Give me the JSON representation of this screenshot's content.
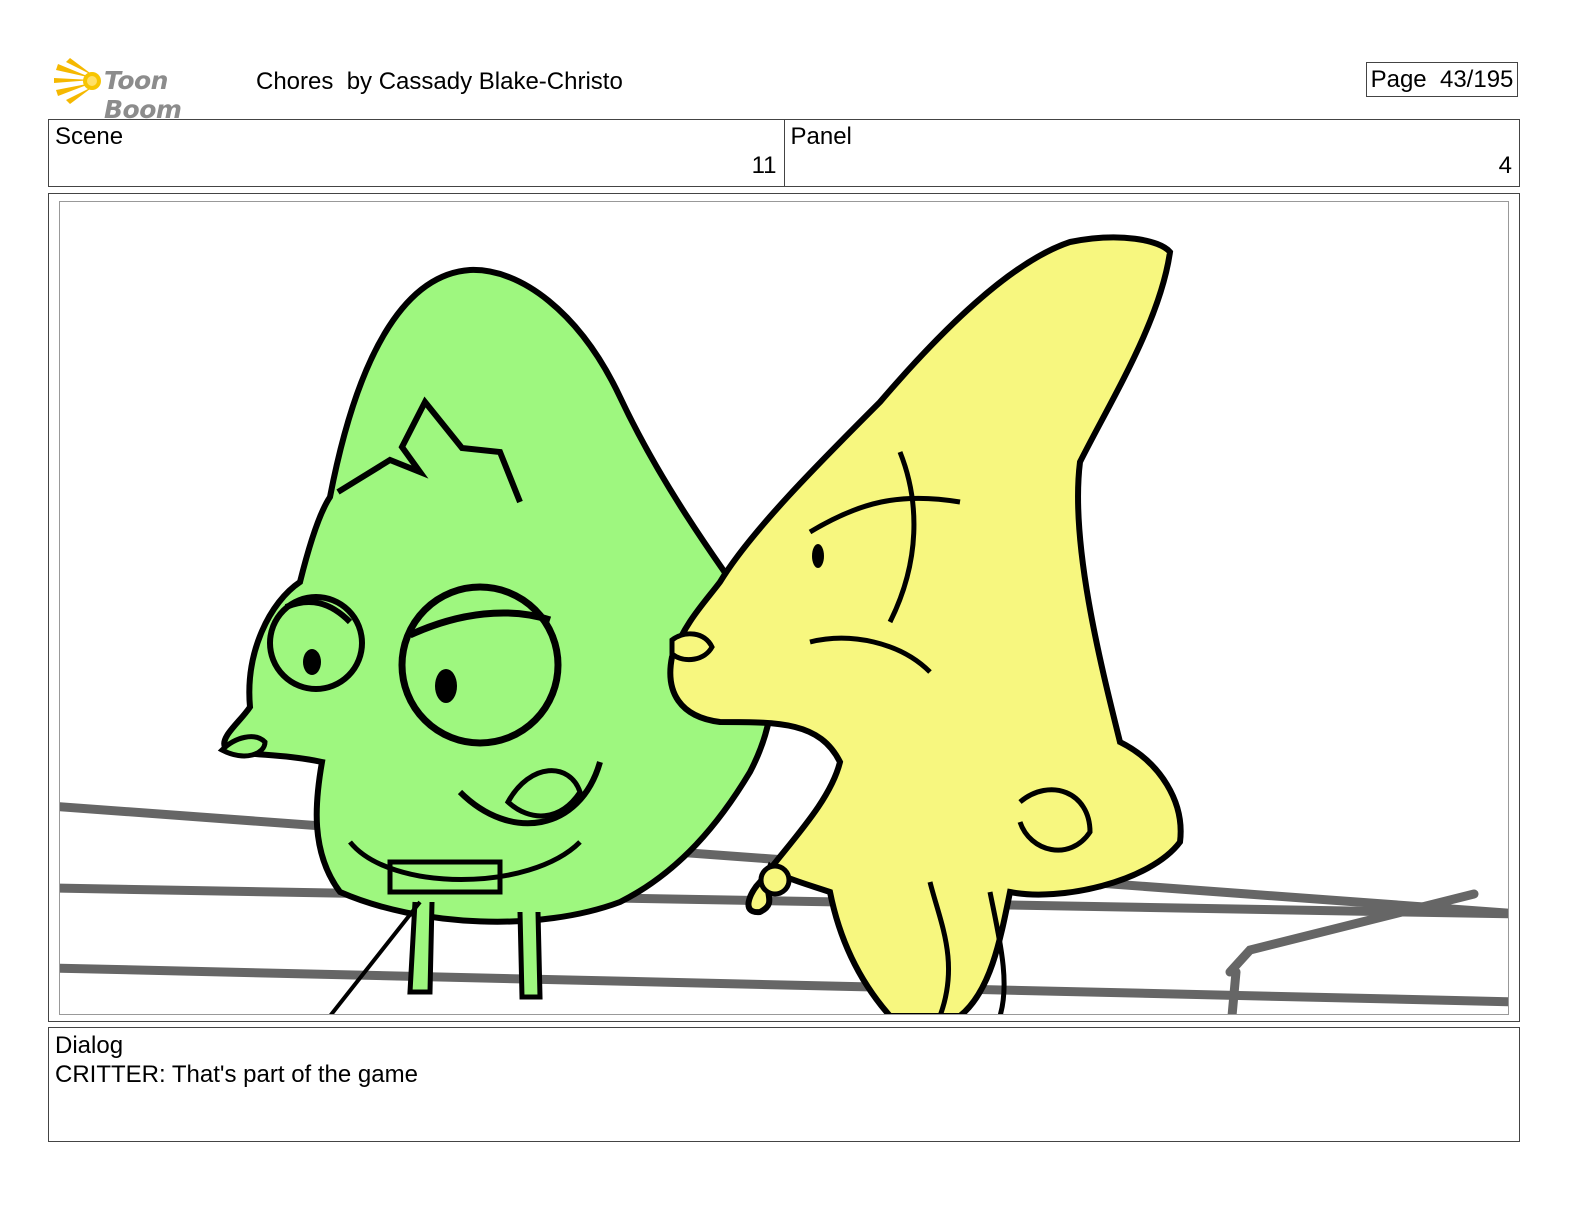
{
  "header": {
    "logo_text": "Toon Boom",
    "title": "Chores  by Cassady Blake-Christo",
    "page_label": "Page  43/195"
  },
  "info": {
    "scene_label": "Scene",
    "scene_value": "11",
    "panel_label": "Panel",
    "panel_value": "4"
  },
  "dialog": {
    "label": "Dialog",
    "text": "CRITTER: That's part of the game"
  },
  "colors": {
    "green_character": "#9ef77f",
    "yellow_character": "#f7f77f",
    "rail": "#666666",
    "logo_star": "#f5b800"
  }
}
